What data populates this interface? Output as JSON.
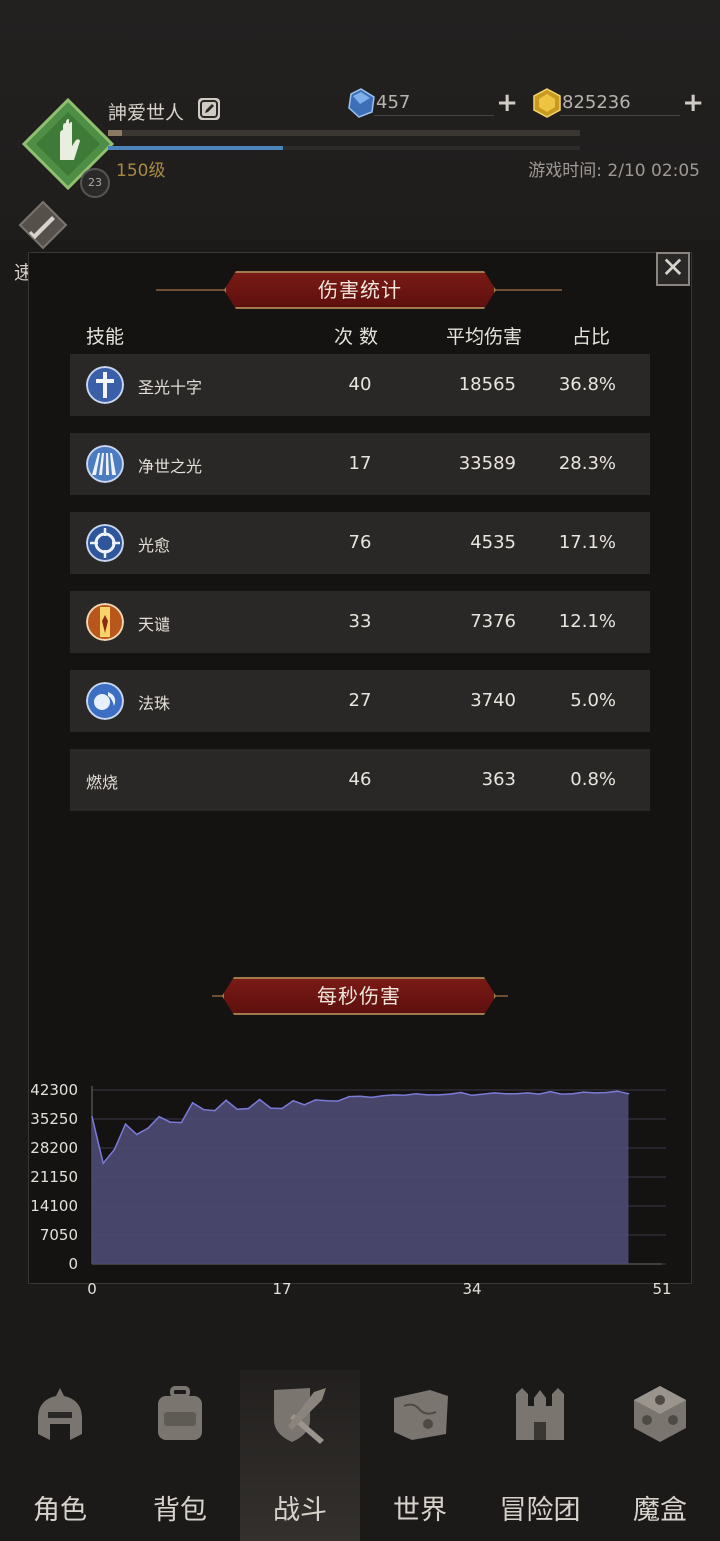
{
  "header": {
    "username": "訷爱世人",
    "level": "150级",
    "game_time": "游戏时间: 2/10 02:05",
    "badge_number": "23",
    "resources": [
      {
        "icon": "blue-crystal-icon",
        "value": "457"
      },
      {
        "icon": "gold-crystal-icon",
        "value": "825236"
      }
    ],
    "speed_battle_label": "速战"
  },
  "modal": {
    "close_label": "✕",
    "title": "伤害统计",
    "columns": {
      "skill": "技能",
      "count": "次 数",
      "avg": "平均伤害",
      "ratio": "占比"
    },
    "rows": [
      {
        "name": "圣光十字",
        "count": "40",
        "avg": "18565",
        "ratio": "36.8%",
        "icon": "holy-cross-icon"
      },
      {
        "name": "净世之光",
        "count": "17",
        "avg": "33589",
        "ratio": "28.3%",
        "icon": "purifying-light-icon"
      },
      {
        "name": "光愈",
        "count": "76",
        "avg": "4535",
        "ratio": "17.1%",
        "icon": "light-heal-icon"
      },
      {
        "name": "天谴",
        "count": "33",
        "avg": "7376",
        "ratio": "12.1%",
        "icon": "divine-wrath-icon"
      },
      {
        "name": "法珠",
        "count": "27",
        "avg": "3740",
        "ratio": "5.0%",
        "icon": "magic-orb-icon"
      },
      {
        "name": "燃烧",
        "count": "46",
        "avg": "363",
        "ratio": "0.8%",
        "icon": ""
      }
    ],
    "dps_title": "每秒伤害"
  },
  "chart_data": {
    "type": "area",
    "title": "每秒伤害",
    "xlim": [
      0,
      51
    ],
    "ylim": [
      0,
      42300
    ],
    "x_ticks": [
      "0",
      "17",
      "34",
      "51"
    ],
    "y_ticks": [
      "42300",
      "35250",
      "28200",
      "21150",
      "14100",
      "7050",
      "0"
    ],
    "grid": true,
    "fill_color": "#4a4970",
    "line_color": "#7a7ad8",
    "x": [
      0,
      1,
      2,
      3,
      4,
      5,
      6,
      7,
      8,
      9,
      10,
      11,
      12,
      13,
      14,
      15,
      16,
      17,
      18,
      19,
      20,
      21,
      22,
      23,
      24,
      25,
      26,
      27,
      28,
      29,
      30,
      31,
      32,
      33,
      34,
      35,
      36,
      37,
      38,
      39,
      40,
      41,
      42,
      43,
      44,
      45,
      46,
      47,
      48
    ],
    "values": [
      35800,
      24500,
      27800,
      34000,
      31500,
      33000,
      35800,
      34500,
      34400,
      39200,
      37500,
      37300,
      39800,
      37600,
      37800,
      40000,
      37900,
      37800,
      39700,
      38700,
      39900,
      39700,
      39600,
      40700,
      40800,
      40500,
      40900,
      41100,
      41000,
      41400,
      41100,
      41100,
      41300,
      41700,
      41000,
      41300,
      41600,
      41400,
      41400,
      41600,
      41300,
      41900,
      41300,
      41400,
      41800,
      41600,
      41700,
      42000,
      41400
    ]
  },
  "nav": [
    {
      "label": "角色",
      "icon": "helmet-icon"
    },
    {
      "label": "背包",
      "icon": "backpack-icon"
    },
    {
      "label": "战斗",
      "icon": "swords-shield-icon",
      "active": true
    },
    {
      "label": "世界",
      "icon": "map-scroll-icon"
    },
    {
      "label": "冒险团",
      "icon": "castle-icon"
    },
    {
      "label": "魔盒",
      "icon": "magic-cube-icon"
    }
  ]
}
